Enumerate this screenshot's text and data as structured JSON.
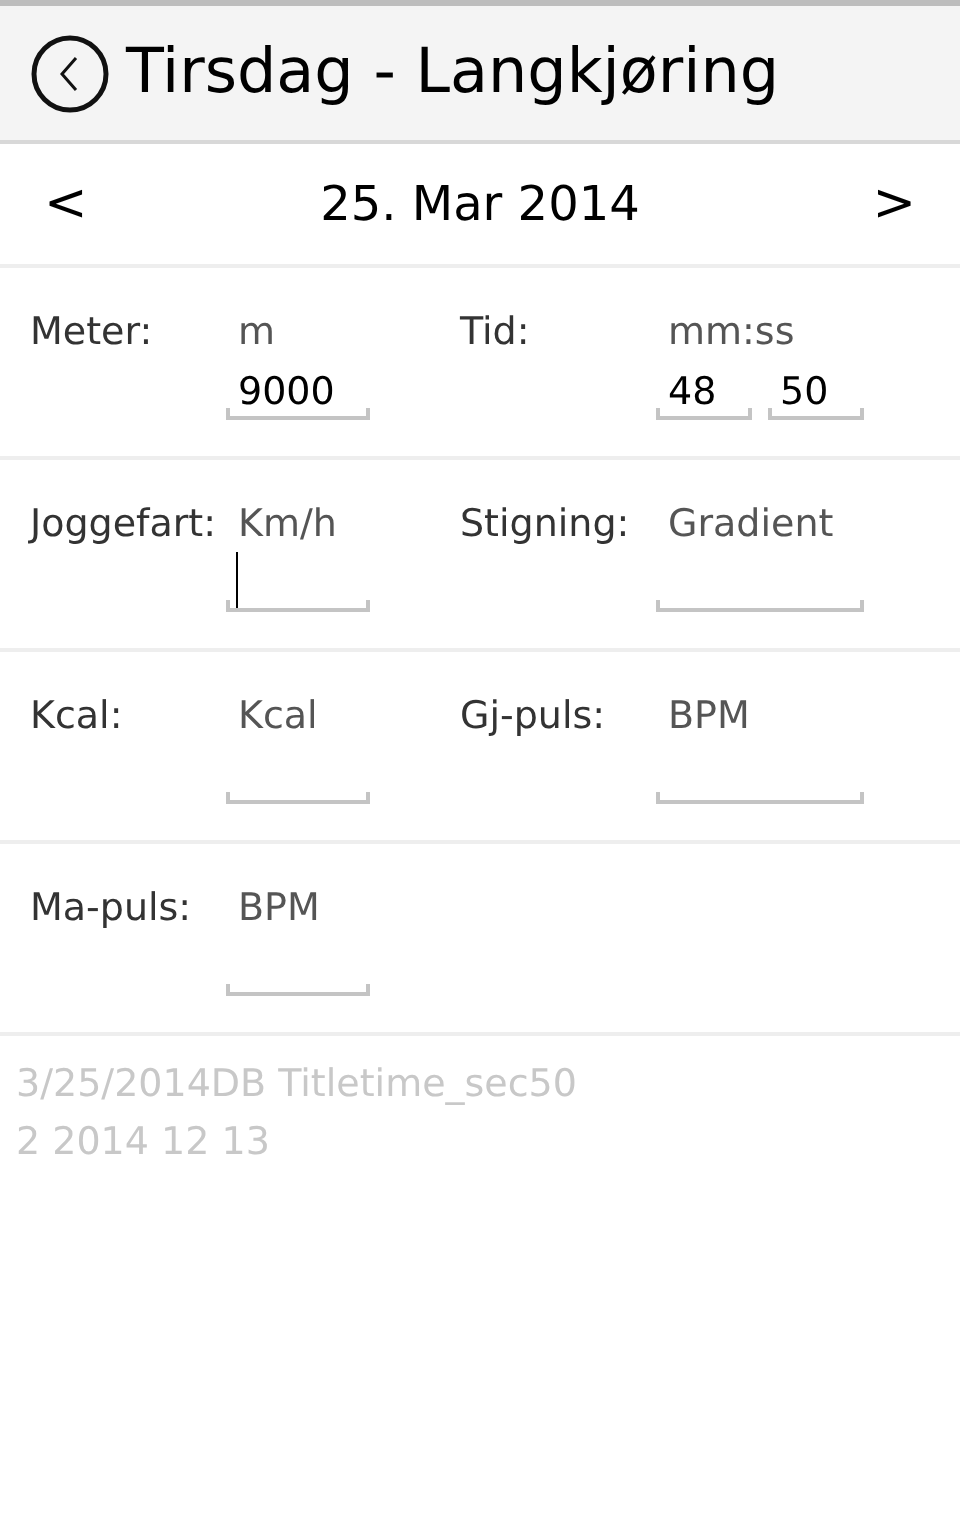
{
  "header": {
    "title": "Tirsdag - Langkjøring"
  },
  "date_nav": {
    "prev": "<",
    "date": "25. Mar 2014",
    "next": ">"
  },
  "rows": [
    {
      "cells": [
        {
          "label": "Meter:",
          "unit": "m",
          "fields": [
            {
              "value": "9000",
              "kind": "medium",
              "focused": false
            }
          ]
        },
        {
          "label": "Tid:",
          "unit": "mm:ss",
          "fields": [
            {
              "value": "48",
              "kind": "small",
              "focused": false
            },
            {
              "value": "50",
              "kind": "small",
              "focused": false
            }
          ]
        }
      ]
    },
    {
      "cells": [
        {
          "label": "Joggefart:",
          "unit": "Km/h",
          "fields": [
            {
              "kind": "medium",
              "focused": true
            }
          ]
        },
        {
          "label": "Stigning:",
          "unit": "Gradient",
          "fields": [
            {
              "kind": "large",
              "focused": false
            }
          ]
        }
      ]
    },
    {
      "cells": [
        {
          "label": "Kcal:",
          "unit": "Kcal",
          "fields": [
            {
              "kind": "medium",
              "focused": false
            }
          ]
        },
        {
          "label": "Gj-puls:",
          "unit": "BPM",
          "fields": [
            {
              "kind": "large",
              "focused": false
            }
          ]
        }
      ]
    },
    {
      "cells": [
        {
          "label": "Ma-puls:",
          "unit": "BPM",
          "fields": [
            {
              "kind": "medium",
              "focused": false
            }
          ]
        }
      ]
    }
  ],
  "debug_lines": [
    "3/25/2014DB Titletime_sec50",
    "2 2014 12 13"
  ]
}
